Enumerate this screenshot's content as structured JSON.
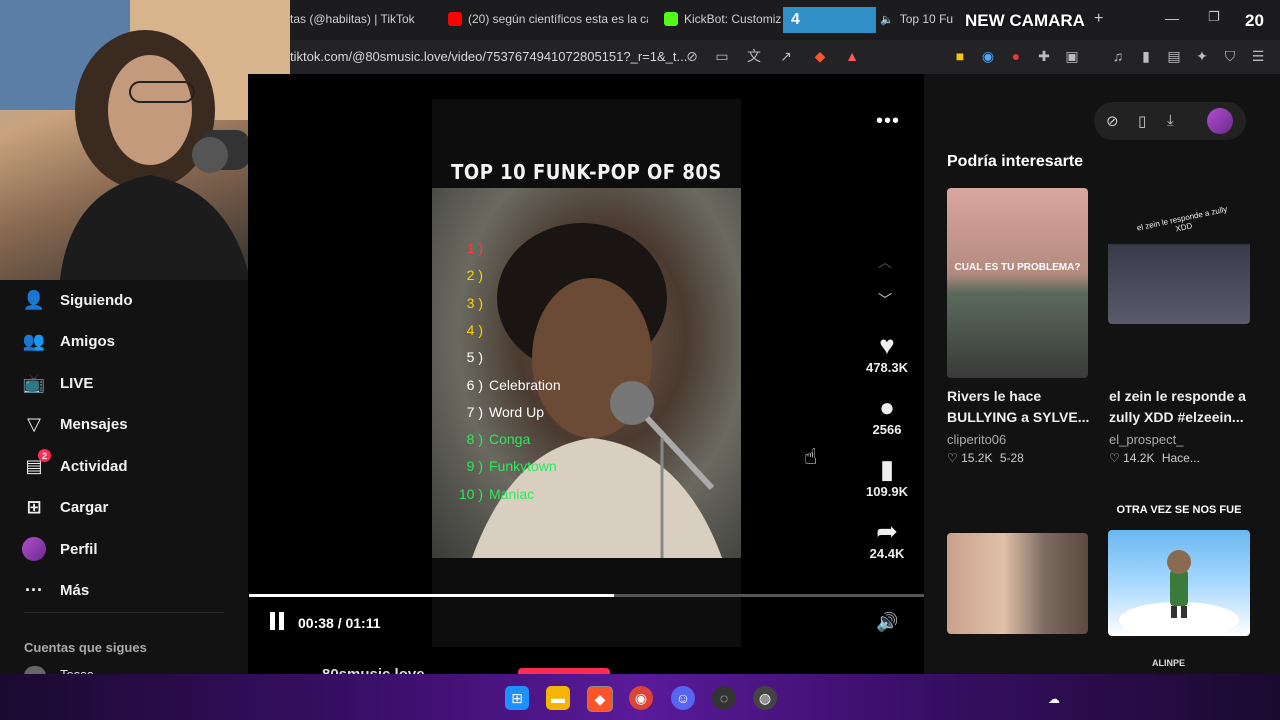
{
  "browser": {
    "tabs": [
      {
        "label": "tas (@habiitas) | TikTok"
      },
      {
        "label": "(20) según científicos esta es la ca"
      },
      {
        "label": "KickBot: Customiza"
      },
      {
        "label": "Top 10 Fu"
      }
    ],
    "url": "tiktok.com/@80smusic.love/video/7537674941072805151?_r=1&_t..."
  },
  "overlay": {
    "counter_left": "4",
    "camera_label": "NEW CAMARA",
    "counter_right": "20"
  },
  "sidebar": {
    "items": [
      {
        "label": "Siguiendo",
        "icon": "person-follow-icon"
      },
      {
        "label": "Amigos",
        "icon": "friends-icon"
      },
      {
        "label": "LIVE",
        "icon": "live-tv-icon"
      },
      {
        "label": "Mensajes",
        "icon": "send-icon"
      },
      {
        "label": "Actividad",
        "icon": "activity-icon",
        "badge": "2"
      },
      {
        "label": "Cargar",
        "icon": "upload-plus-icon"
      },
      {
        "label": "Perfil",
        "icon": "avatar-icon"
      },
      {
        "label": "Más",
        "icon": "more-dots-icon"
      }
    ],
    "following_header": "Cuentas que sigues",
    "following_first": "Tessa-"
  },
  "video": {
    "title": "TOP 10 FUNK-POP OF 80S",
    "ranks": [
      {
        "num": "1 )",
        "song": "",
        "color": "#ff3b3b"
      },
      {
        "num": "2 )",
        "song": "",
        "color": "#ffd400"
      },
      {
        "num": "3 )",
        "song": "",
        "color": "#ffd400"
      },
      {
        "num": "4 )",
        "song": "",
        "color": "#ffd400"
      },
      {
        "num": "5 )",
        "song": "",
        "color": "#ffffff"
      },
      {
        "num": "6 )",
        "song": "Celebration",
        "color": "#ffffff"
      },
      {
        "num": "7 )",
        "song": "Word Up",
        "color": "#ffffff"
      },
      {
        "num": "8 )",
        "song": "Conga",
        "color": "#2ee85a"
      },
      {
        "num": "9 )",
        "song": "Funkytown",
        "color": "#2ee85a"
      },
      {
        "num": "10 )",
        "song": "Maniac",
        "color": "#2ee85a"
      }
    ],
    "time": "00:38 / 01:11",
    "progress": 0.54,
    "author": "80smusic.love"
  },
  "actions": {
    "likes": "478.3K",
    "comments": "2566",
    "saves": "109.9K",
    "shares": "24.4K"
  },
  "recommend": {
    "title": "Podría interesarte",
    "cards": [
      {
        "title": "Rivers le hace BULLYING a SYLVE...",
        "author": "cliperito06",
        "likes": "15.2K",
        "date": "5-28",
        "overlay": "CUAL ES TU PROBLEMA?"
      },
      {
        "title": "el zein le responde a zully XDD #elzeein...",
        "author": "el_prospect_",
        "likes": "14.2K",
        "date": "Hace...",
        "overlay": "el zein le responde a zully XDD"
      },
      {
        "title": "",
        "author": "",
        "likes": "",
        "date": "",
        "overlay": ""
      },
      {
        "title": "",
        "author": "",
        "likes": "",
        "date": "",
        "overlay": "OTRA VEZ SE NOS FUE"
      }
    ],
    "watermark": "ALINPE"
  },
  "colors": {
    "accent": "#fe2c55",
    "overlay_blue": "#2f8fc6"
  }
}
